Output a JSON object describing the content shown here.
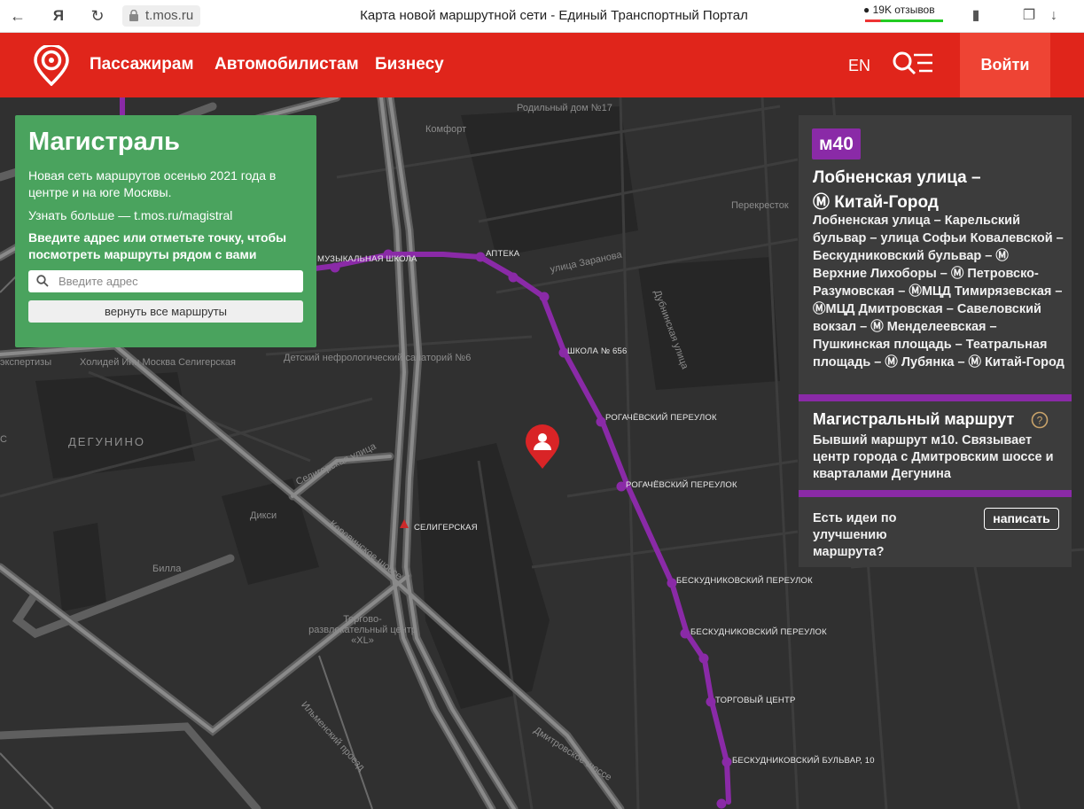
{
  "browser": {
    "url": "t.mos.ru",
    "title": "Карта новой маршрутной сети - Единый Транспортный Портал",
    "reviews": "19K отзывов"
  },
  "header": {
    "nav": [
      "Пассажирам",
      "Автомобилистам",
      "Бизнесу"
    ],
    "lang": "EN",
    "login": "Войти"
  },
  "left_panel": {
    "title": "Магистраль",
    "description": "Новая сеть маршрутов осенью 2021 года в центре и на юге Москвы.",
    "more": "Узнать больше — t.mos.ru/magistral",
    "prompt": "Введите адрес или отметьте точку, чтобы посмотреть маршруты рядом с вами",
    "search_placeholder": "Введите адрес",
    "reset_button": "вернуть все маршруты"
  },
  "route": {
    "badge": "м40",
    "name_line1": "Лобненская улица –",
    "name_line2": "Китай-Город",
    "stops": "Лобненская улица – Карельский бульвар – улица Софьи Ковалевской – Бескудниковский бульвар – Ⓜ Верхние Лихоборы – Ⓜ Петровско-Разумовская – ⓂМЦД Тимирязевская – ⓂМЦД Дмитровская – Савеловский вокзал – Ⓜ Менделеевская – Пушкинская площадь – Театральная площадь – Ⓜ Лубянка – Ⓜ Китай-Город",
    "magistral_title": "Магистральный маршрут",
    "magistral_desc": "Бывший маршрут м10. Связывает центр города с Дмитровским шоссе и кварталами Дегунина",
    "ideas": "Есть идеи по улучшению маршрута?",
    "write_button": "написать"
  },
  "map": {
    "stops": [
      "МУЗЫКАЛЬНАЯ ШКОЛА",
      "АПТЕКА",
      "ШКОЛА № 656",
      "РОГАЧЁВСКИЙ ПЕРЕУЛОК",
      "РОГАЧЁВСКИЙ ПЕРЕУЛОК",
      "БЕСКУДНИКОВСКИЙ ПЕРЕУЛОК",
      "БЕСКУДНИКОВСКИЙ ПЕРЕУЛОК",
      "ТОРГОВЫЙ ЦЕНТР",
      "БЕСКУДНИКОВСКИЙ БУЛЬВАР, 10",
      "СЕЛИГЕРСКАЯ"
    ],
    "places": [
      "Родильный дом №17",
      "Комфорт",
      "Перекресток",
      "улица Заранова",
      "Дубнинская улица",
      "Детский нефрологический санаторий №6",
      "Холидей Инн Москва Селигерская",
      "Селигерская улица",
      "Дикси",
      "Билла",
      "Торгово-развлекательный центр «XL»",
      "Ильменский проезд",
      "Дмитровское шоссе",
      "Коровинское шоссе",
      "экспертизы",
      "С"
    ],
    "district": "ДЕГУНИНО"
  }
}
